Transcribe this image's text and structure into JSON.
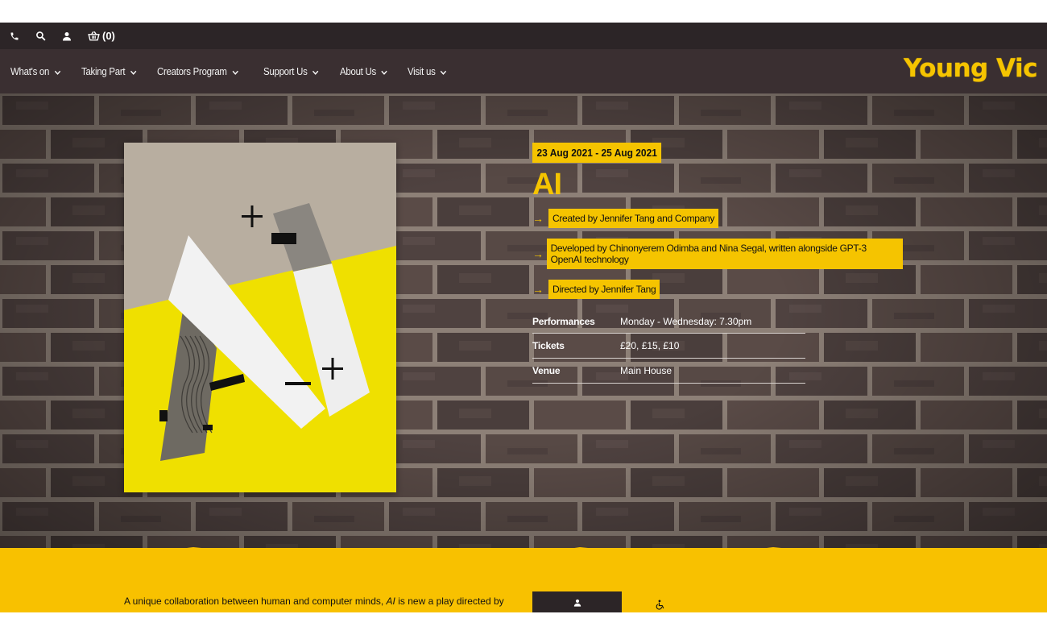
{
  "utility": {
    "cart_count": "(0)",
    "icons": [
      "phone-icon",
      "search-icon",
      "user-icon",
      "basket-icon"
    ]
  },
  "nav": {
    "items": [
      {
        "label": "What's on"
      },
      {
        "label": "Taking Part"
      },
      {
        "label": "Creators Program"
      },
      {
        "label": "Support Us"
      },
      {
        "label": "About Us"
      },
      {
        "label": "Visit us"
      }
    ],
    "logo": "Young Vic"
  },
  "show": {
    "dates": "23 Aug 2021 - 25 Aug 2021",
    "title": "AI",
    "credits": [
      "Created by Jennifer Tang and Company",
      "Developed by Chinonyerem Odimba and Nina Segal, written alongside GPT-3 OpenAI technology",
      "Directed by Jennifer Tang"
    ],
    "info": [
      {
        "label": "Performances",
        "value": "Monday - Wednesday: 7.30pm"
      },
      {
        "label": "Tickets",
        "value": "£20, £15, £10"
      },
      {
        "label": "Venue",
        "value": "Main House"
      }
    ]
  },
  "intro": {
    "before_italic": "A unique collaboration between human and computer minds, ",
    "italic": "AI",
    "after_italic": " is new a play directed by"
  },
  "colors": {
    "accent": "#f5c400",
    "dark_bar": "#2c2527",
    "nav_bg": "#3a2f31"
  }
}
